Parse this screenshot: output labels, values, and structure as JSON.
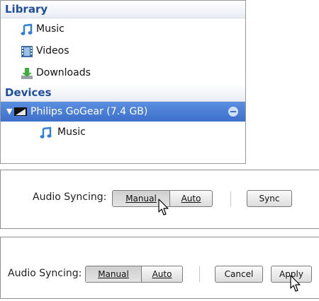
{
  "library": {
    "header": "Library",
    "items": [
      {
        "label": "Music",
        "icon": "music-note-icon"
      },
      {
        "label": "Videos",
        "icon": "film-icon"
      },
      {
        "label": "Downloads",
        "icon": "download-icon"
      }
    ]
  },
  "devices": {
    "header": "Devices",
    "device": {
      "label": "Philips GoGear (7.4 GB)",
      "icon": "device-icon"
    },
    "children": [
      {
        "label": "Music",
        "icon": "music-note-icon"
      }
    ]
  },
  "sync_panel_1": {
    "caption": "Audio Syncing:",
    "manual_label": "Manual",
    "auto_label": "Auto",
    "sync_label": "Sync"
  },
  "sync_panel_2": {
    "caption": "Audio Syncing:",
    "manual_label": "Manual",
    "auto_label": "Auto",
    "cancel_label": "Cancel",
    "apply_label": "Apply"
  },
  "colors": {
    "header_text": "#1f4e9c",
    "selection": "#3d6fca"
  }
}
